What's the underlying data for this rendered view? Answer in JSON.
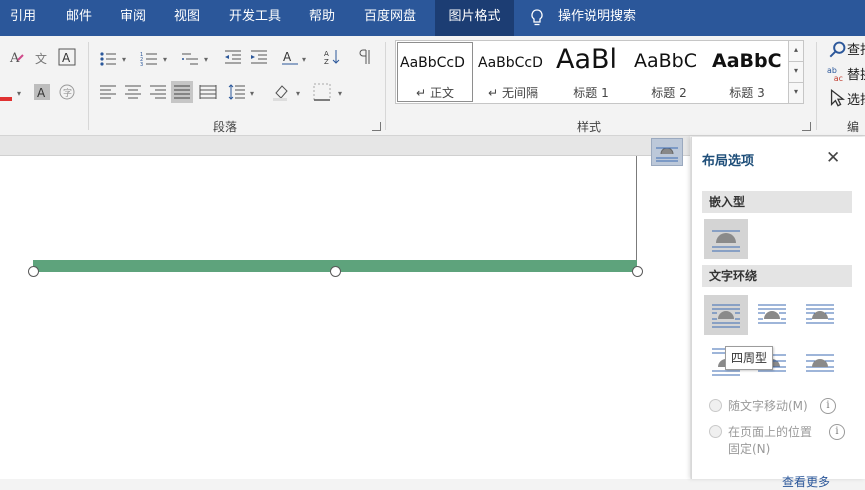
{
  "ribbon": {
    "tabs": [
      {
        "label": "引用"
      },
      {
        "label": "邮件"
      },
      {
        "label": "审阅"
      },
      {
        "label": "视图"
      },
      {
        "label": "开发工具"
      },
      {
        "label": "帮助"
      },
      {
        "label": "百度网盘"
      },
      {
        "label": "图片格式",
        "active": true
      }
    ],
    "tell_me": "操作说明搜索",
    "groups": {
      "paragraph_label": "段落",
      "styles_label": "样式",
      "editing_label": "编辑"
    },
    "styles": [
      {
        "preview": "AaBbCcD",
        "name": "正文",
        "mark": "↵"
      },
      {
        "preview": "AaBbCcD",
        "name": "无间隔",
        "mark": "↵"
      },
      {
        "preview": "AaBl",
        "name": "标题 1"
      },
      {
        "preview": "AaBbC",
        "name": "标题 2"
      },
      {
        "preview": "AaBbC",
        "name": "标题 3"
      }
    ],
    "editing": {
      "find": "查找",
      "replace": "替换",
      "select": "选择"
    },
    "colors": {
      "ribbon": "#2b579a",
      "font_red": "#e03131",
      "selection_bar": "#5ea37c"
    }
  },
  "layout_panel": {
    "title": "布局选项",
    "close_icon": "close-icon",
    "inline_header": "嵌入型",
    "wrap_header": "文字环绕",
    "tooltip": "四周型",
    "move_with_text": "随文字移动(M)",
    "fix_position_line1": "在页面上的位置",
    "fix_position_line2": "固定(N)",
    "see_more": "查看更多"
  }
}
